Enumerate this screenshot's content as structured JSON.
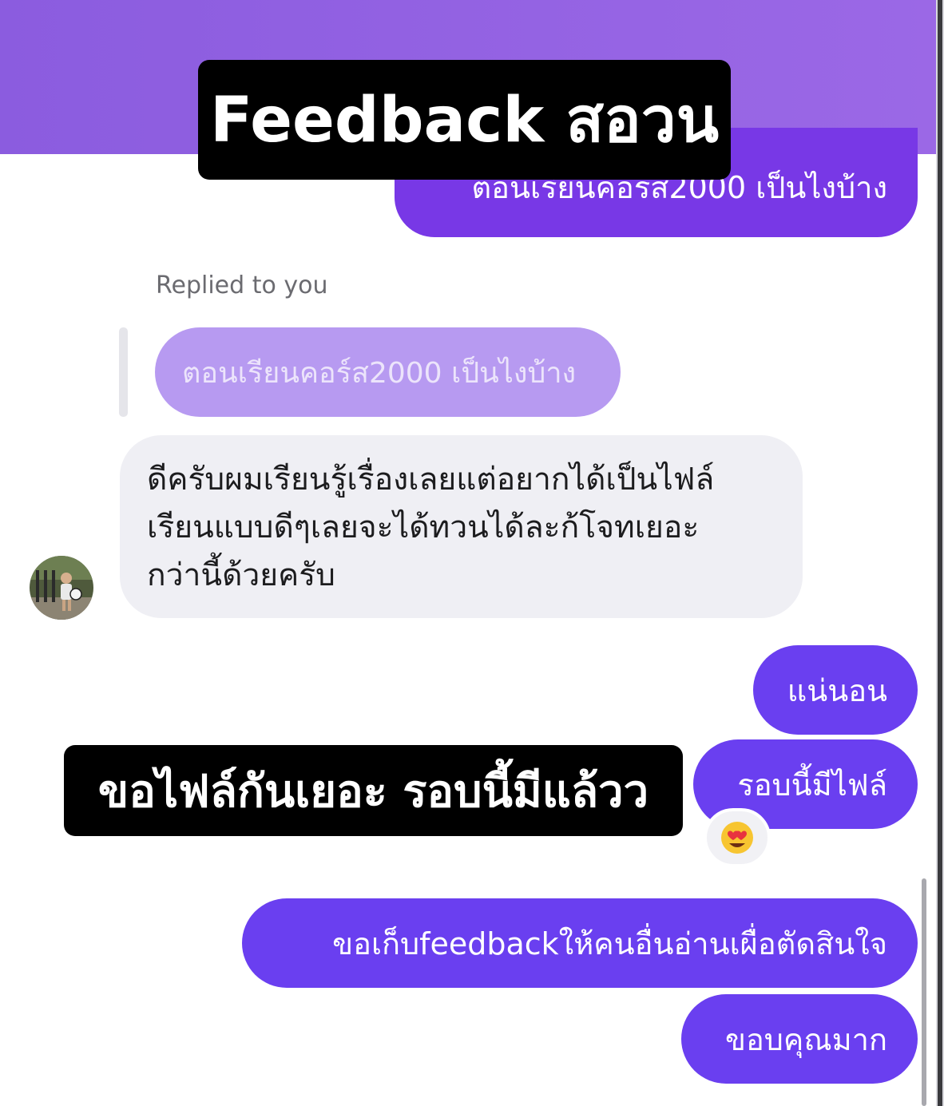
{
  "overlay": {
    "top_caption": "Feedback สอวน",
    "middle_caption": "ขอไฟล์กันเยอะ รอบนี้มีแล้วว"
  },
  "thread": {
    "outgoing_top": "ตอนเรียนคอร์ส2000 เป็นไงบ้าง",
    "replied_label": "Replied to you",
    "quoted_message": "ตอนเรียนคอร์ส2000 เป็นไงบ้าง",
    "incoming_message_lines": [
      "ดีครับผมเรียนรู้เรื่องเลยแต่อยากได้เป็นไฟล์",
      "เรียนแบบดีๆเลยจะได้ทวนได้ละก้โจทเยอะ",
      "กว่านี้ด้วยครับ"
    ],
    "outgoing_sure": "แน่นอน",
    "outgoing_file": "รอบนี้มีไฟล์",
    "reaction_icon": "heart-eyes-emoji",
    "outgoing_keep": "ขอเก็บfeedbackให้คนอื่นอ่านเผื่อตัดสินใจ",
    "outgoing_thanks": "ขอบคุณมาก"
  },
  "colors": {
    "header_purple": "#8b5cdf",
    "outgoing_bubble": "#6a3ff0",
    "quoted_bubble": "#b79af1",
    "incoming_bubble": "#efeff4",
    "caption_bg": "#000000"
  }
}
